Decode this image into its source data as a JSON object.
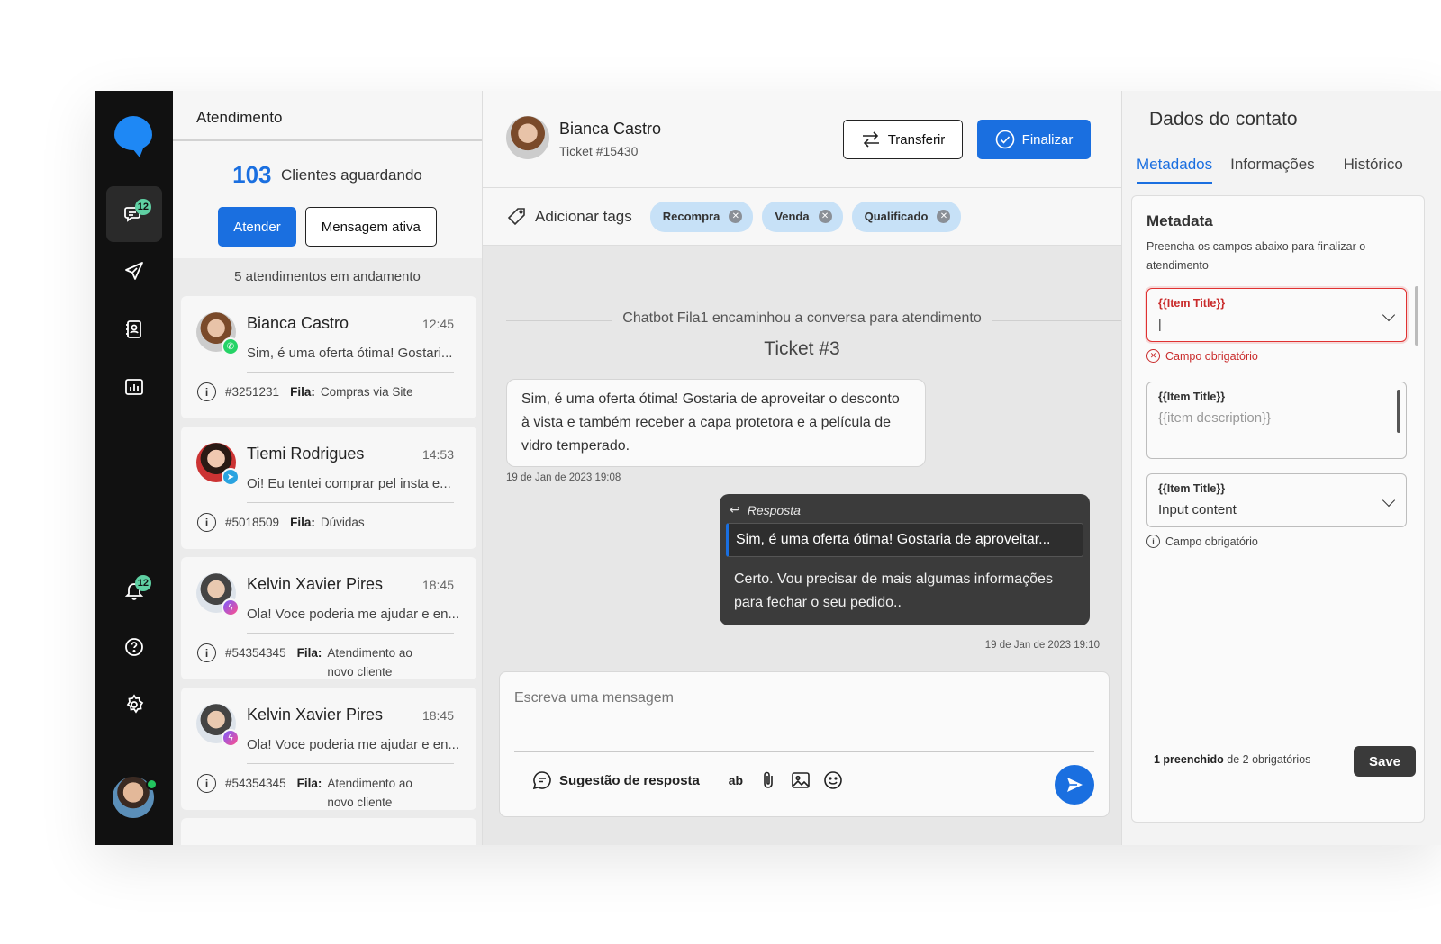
{
  "sidebar": {
    "chat_badge": "12",
    "notif_badge": "12"
  },
  "list": {
    "header": "Atendimento",
    "waiting_count": "103",
    "waiting_label": "Clientes aguardando",
    "attend_label": "Atender",
    "active_msg_label": "Mensagem ativa",
    "in_progress": "5 atendimentos em andamento",
    "fila_label": "Fila:",
    "cards": [
      {
        "name": "Bianca Castro",
        "time": "12:45",
        "preview": "Sim, é uma oferta ótima! Gostari...",
        "id": "#3251231",
        "fila": "Compras via Site",
        "channel": "whatsapp-icon"
      },
      {
        "name": "Tiemi Rodrigues",
        "time": "14:53",
        "preview": "Oi! Eu tentei comprar pel insta e...",
        "id": "#5018509",
        "fila": "Dúvidas",
        "channel": "telegram-icon"
      },
      {
        "name": "Kelvin Xavier Pires",
        "time": "18:45",
        "preview": "Ola! Voce poderia me ajudar e en...",
        "id": "#54354345",
        "fila": "Atendimento ao novo cliente",
        "channel": "messenger-icon"
      },
      {
        "name": "Kelvin Xavier Pires",
        "time": "18:45",
        "preview": "Ola! Voce poderia me ajudar e en...",
        "id": "#54354345",
        "fila": "Atendimento ao novo cliente",
        "channel": "messenger-icon"
      }
    ]
  },
  "chat": {
    "contact_name": "Bianca Castro",
    "ticket": "Ticket #15430",
    "transfer_label": "Transferir",
    "finalize_label": "Finalizar",
    "add_tags_label": "Adicionar tags",
    "tags": [
      "Recompra",
      "Venda",
      "Qualificado"
    ],
    "system_message": "Chatbot Fila1 encaminhou a conversa para atendimento",
    "ticket_divider": "Ticket #3",
    "incoming_text": "Sim, é uma oferta ótima! Gostaria de aproveitar o desconto à vista e também receber a capa protetora e a película de vidro temperado.",
    "incoming_time": "19 de Jan de 2023 19:08",
    "reply_label": "Resposta",
    "reply_quote": "Sim, é uma oferta ótima! Gostaria de aproveitar...",
    "outgoing_text": "Certo. Vou precisar de mais algumas informações para fechar o seu pedido..",
    "outgoing_time": "19 de Jan de 2023 19:10",
    "composer_placeholder": "Escreva uma mensagem",
    "suggest_label": "Sugestão de resposta",
    "format_label": "ab"
  },
  "contact": {
    "title": "Dados do contato",
    "tabs": [
      "Metadados",
      "Informações",
      "Histórico"
    ],
    "metadata_title": "Metadata",
    "metadata_desc": "Preencha os campos abaixo para finalizar o atendimento",
    "field1_title": "{{Item Title}}",
    "field1_error": "Campo obrigatório",
    "field2_title": "{{Item Title}}",
    "field2_placeholder": "{{item description}}",
    "field3_title": "{{Item Title}}",
    "field3_value": "Input content",
    "field3_hint": "Campo obrigatório",
    "filled_count": "1 preenchido",
    "required_count": "de 2 obrigatórios",
    "save_label": "Save"
  },
  "colors": {
    "accent": "#1a6fe0",
    "sidebar_bg": "#111111",
    "tag_bg": "#c7e1f7",
    "error": "#e03131",
    "badge": "#5fd0a3"
  }
}
